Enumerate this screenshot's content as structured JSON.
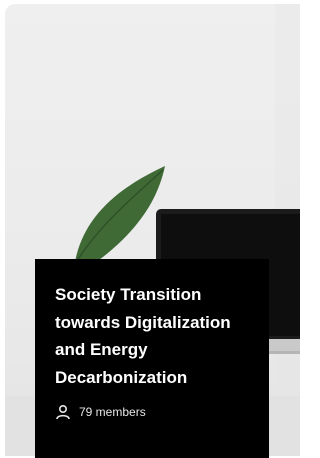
{
  "community": {
    "title": "Society Transition towards Digitalization and Energy Decarbonization",
    "members": "79 members"
  },
  "icons": {
    "members": "person-icon"
  },
  "colors": {
    "panel_background": "#000000",
    "panel_text": "#ffffff",
    "photo_background": "#ececec"
  }
}
